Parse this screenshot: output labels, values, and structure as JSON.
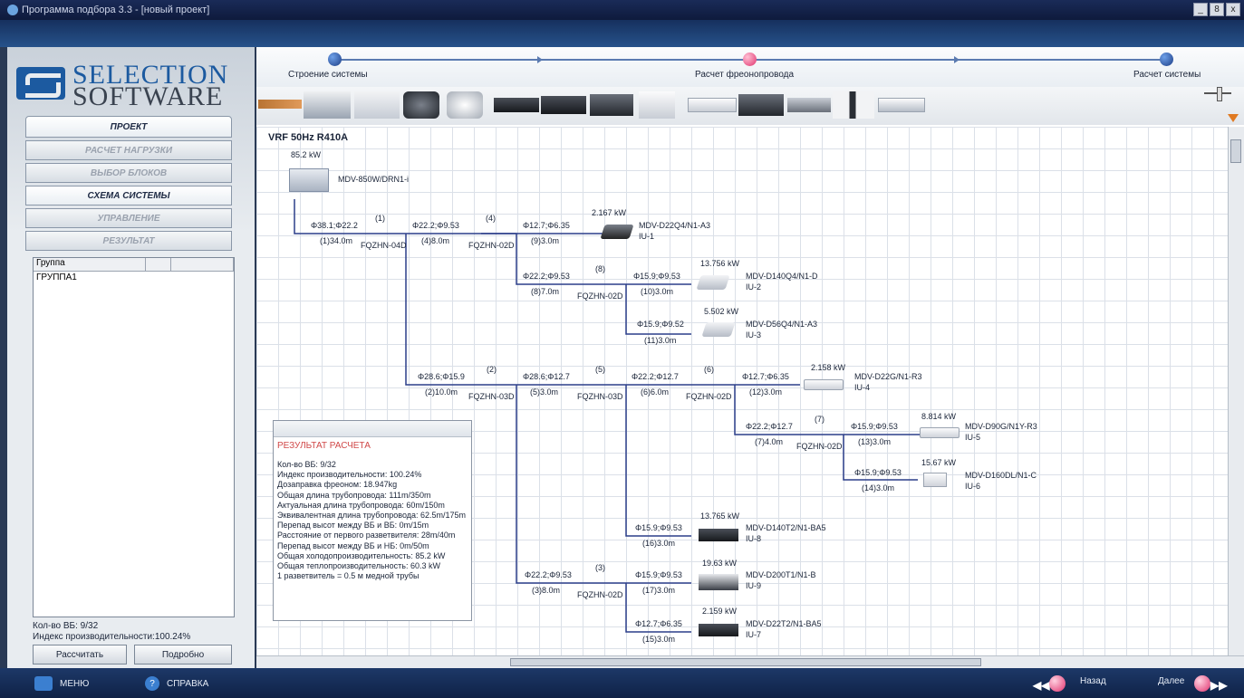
{
  "window": {
    "title": "Программа подбора 3.3 - [новый проект]",
    "controls": [
      "_",
      "8",
      "x"
    ]
  },
  "logo": {
    "line1": "SELECTION",
    "line2": "SOFTWARE"
  },
  "nav": {
    "project": "ПРОЕКТ",
    "load_calc": "РАСЧЕТ НАГРУЗКИ",
    "unit_select": "ВЫБОР БЛОКОВ",
    "system_scheme": "СХЕМА СИСТЕМЫ",
    "control": "УПРАВЛЕНИЕ",
    "result": "РЕЗУЛЬТАТ"
  },
  "group_table": {
    "header": "Группа",
    "rows": [
      "ГРУППА1"
    ]
  },
  "left_status": {
    "count": "Кол-во ВБ: 9/32",
    "index": "Индекс производительности:100.24%"
  },
  "left_buttons": {
    "calculate": "Рассчитать",
    "details": "Подробно"
  },
  "steps": {
    "s1": "Строение системы",
    "s2": "Расчет фреонопровода",
    "s3": "Расчет системы"
  },
  "diagram": {
    "title": "VRF 50Hz R410A",
    "odu": {
      "kw": "85.2  kW",
      "model": "MDV-850W/DRN1-i"
    },
    "pipes": {
      "p1a": "Φ38.1;Φ22.2",
      "p1b": "(1)34.0m",
      "p4a": "Φ22.2;Φ9.53",
      "p4b": "(4)8.0m",
      "p9a": "Φ12.7;Φ6.35",
      "p9b": "(9)3.0m",
      "p8a": "Φ22.2;Φ9.53",
      "p8b": "(8)7.0m",
      "p10a": "Φ15.9;Φ9.53",
      "p10b": "(10)3.0m",
      "p11a": "Φ15.9;Φ9.52",
      "p11b": "(11)3.0m",
      "p2a": "Φ28.6;Φ15.9",
      "p2b": "(2)10.0m",
      "p5a": "Φ28.6;Φ12.7",
      "p5b": "(5)3.0m",
      "p6a": "Φ22.2;Φ12.7",
      "p6b": "(6)6.0m",
      "p12a": "Φ12.7;Φ6.35",
      "p12b": "(12)3.0m",
      "p7a": "Φ22.2;Φ12.7",
      "p7b": "(7)4.0m",
      "p13a": "Φ15.9;Φ9.53",
      "p13b": "(13)3.0m",
      "p14a": "Φ15.9;Φ9.53",
      "p14b": "(14)3.0m",
      "p16a": "Φ15.9;Φ9.53",
      "p16b": "(16)3.0m",
      "p3a": "Φ22.2;Φ9.53",
      "p3b": "(3)8.0m",
      "p17a": "Φ15.9;Φ9.53",
      "p17b": "(17)3.0m",
      "p15a": "Φ12.7;Φ6.35",
      "p15b": "(15)3.0m"
    },
    "branches": {
      "b1": {
        "num": "(1)",
        "model": "FQZHN-04D"
      },
      "b4": {
        "num": "(4)",
        "model": "FQZHN-02D"
      },
      "b8": {
        "num": "(8)",
        "model": "FQZHN-02D"
      },
      "b2": {
        "num": "(2)",
        "model": "FQZHN-03D"
      },
      "b5": {
        "num": "(5)",
        "model": "FQZHN-03D"
      },
      "b6": {
        "num": "(6)",
        "model": "FQZHN-02D"
      },
      "b7": {
        "num": "(7)",
        "model": "FQZHN-02D"
      },
      "b3": {
        "num": "(3)",
        "model": "FQZHN-02D"
      }
    },
    "indoor": {
      "iu1": {
        "kw": "2.167  kW",
        "model": "MDV-D22Q4/N1-A3",
        "id": "IU-1"
      },
      "iu2": {
        "kw": "13.756  kW",
        "model": "MDV-D140Q4/N1-D",
        "id": "IU-2"
      },
      "iu3": {
        "kw": "5.502  kW",
        "model": "MDV-D56Q4/N1-A3",
        "id": "IU-3"
      },
      "iu4": {
        "kw": "2.158  kW",
        "model": "MDV-D22G/N1-R3",
        "id": "IU-4"
      },
      "iu5": {
        "kw": "8.814  kW",
        "model": "MDV-D90G/N1Y-R3",
        "id": "IU-5"
      },
      "iu6": {
        "kw": "15.67  kW",
        "model": "MDV-D160DL/N1-C",
        "id": "IU-6"
      },
      "iu8": {
        "kw": "13.765  kW",
        "model": "MDV-D140T2/N1-BA5",
        "id": "IU-8"
      },
      "iu9": {
        "kw": "19.63  kW",
        "model": "MDV-D200T1/N1-B",
        "id": "IU-9"
      },
      "iu7": {
        "kw": "2.159  kW",
        "model": "MDV-D22T2/N1-BA5",
        "id": "IU-7"
      }
    }
  },
  "result": {
    "title": "РЕЗУЛЬТАТ РАСЧЕТА",
    "lines": [
      "Кол-во ВБ: 9/32",
      "Индекс производительности: 100.24%",
      "Дозаправка фреоном: 18.947kg",
      "Общая длина трубопровода: 111m/350m",
      "Актуальная длина трубопровода: 60m/150m",
      "Эквивалентная длина трубопровода: 62.5m/175m",
      "Перепад высот между ВБ и ВБ: 0m/15m",
      "Расстояние от первого разветвителя: 28m/40m",
      "Перепад высот между ВБ и НБ: 0m/50m",
      "Общая холодопроизводительность: 85.2  kW",
      "Общая теплопроизводительность: 60.3  kW",
      "1 разветвитель = 0.5 м медной трубы"
    ]
  },
  "bottom": {
    "menu": "МЕНЮ",
    "help": "СПРАВКА",
    "back": "Назад",
    "next": "Далее"
  }
}
